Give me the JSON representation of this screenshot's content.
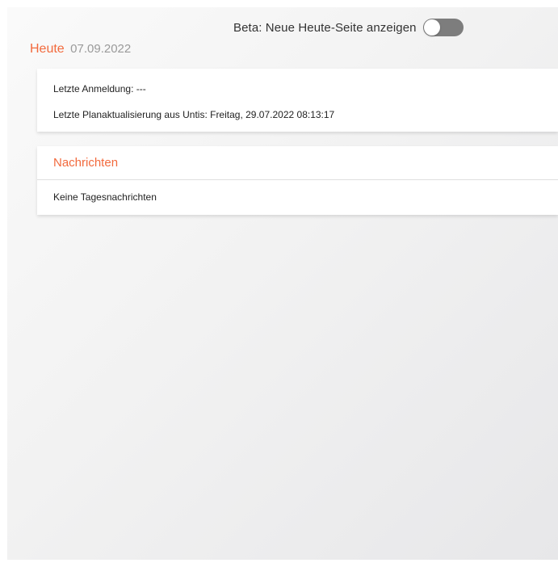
{
  "beta": {
    "label": "Beta: Neue Heute-Seite anzeigen",
    "toggle_on": false
  },
  "heading": {
    "title": "Heute",
    "date": "07.09.2022"
  },
  "info": {
    "last_login": "Letzte Anmeldung: ---",
    "last_update": "Letzte Planaktualisierung aus Untis: Freitag, 29.07.2022 08:13:17"
  },
  "news": {
    "title": "Nachrichten",
    "empty_text": "Keine Tagesnachrichten"
  },
  "colors": {
    "accent": "#f26a3d",
    "toggle_off": "#7d7d7d",
    "muted_text": "#9a9a9a"
  }
}
